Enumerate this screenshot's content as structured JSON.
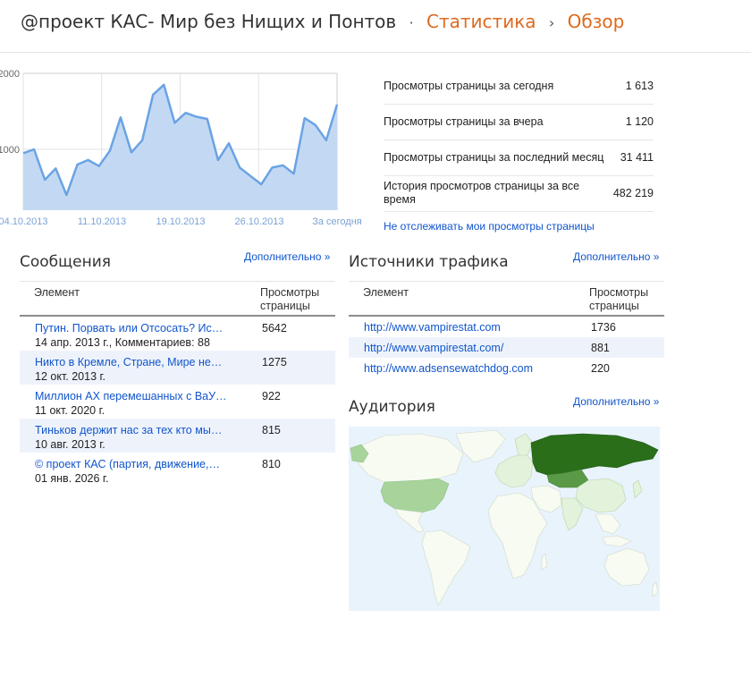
{
  "header": {
    "blog_name": "@проект КАС- Мир без Нищих и Понтов",
    "dot": "·",
    "section": "Статистика",
    "arrow": "›",
    "page": "Обзор"
  },
  "chart_data": {
    "type": "area",
    "x_tick_labels": [
      "04.10.2013",
      "11.10.2013",
      "19.10.2013",
      "26.10.2013",
      "За сегодня"
    ],
    "y_tick_labels": [
      "2000",
      "1000"
    ],
    "ylim": [
      200,
      2000
    ],
    "values": [
      950,
      1000,
      600,
      750,
      400,
      800,
      860,
      780,
      980,
      1420,
      960,
      1120,
      1720,
      1850,
      1350,
      1480,
      1430,
      1400,
      860,
      1080,
      760,
      650,
      540,
      760,
      790,
      680,
      1410,
      1320,
      1120,
      1590
    ],
    "color": "#6aa3e3",
    "fill": "#c3d9f3"
  },
  "stats": {
    "rows": [
      {
        "label": "Просмотры страницы за сегодня",
        "value": "1 613"
      },
      {
        "label": "Просмотры страницы за вчера",
        "value": "1 120"
      },
      {
        "label": "Просмотры страницы за последний месяц",
        "value": "31 411"
      },
      {
        "label": "История просмотров страницы за все время",
        "value": "482 219"
      }
    ],
    "toggle": "Не отслеживать мои просмотры страницы"
  },
  "messages": {
    "title": "Сообщения",
    "more": "Дополнительно »",
    "col_element": "Элемент",
    "col_views": "Просмотры страницы",
    "rows": [
      {
        "title": "Путин. Порвать или Отсосать? Ис…",
        "sub": "14 апр. 2013 г., Комментариев: 88",
        "views": "5642"
      },
      {
        "title": "Никто в Кремле, Стране, Мире не…",
        "sub": "12 окт. 2013 г.",
        "views": "1275"
      },
      {
        "title": "Миллион АХ перемешанных с ВаУ…",
        "sub": "11 окт. 2020 г.",
        "views": "922"
      },
      {
        "title": "Тиньков держит нас за тех кто мы…",
        "sub": "10 авг. 2013 г.",
        "views": "815"
      },
      {
        "title": "© проект КАС (партия, движение,…",
        "sub": "01 янв. 2026 г.",
        "views": "810"
      }
    ]
  },
  "traffic": {
    "title": "Источники трафика",
    "more": "Дополнительно »",
    "col_element": "Элемент",
    "col_views": "Просмотры страницы",
    "rows": [
      {
        "url": "http://www.vampirestat.com",
        "views": "1736"
      },
      {
        "url": "http://www.vampirestat.com/",
        "views": "881"
      },
      {
        "url": "http://www.adsensewatchdog.com",
        "views": "220"
      }
    ]
  },
  "audience": {
    "title": "Аудитория",
    "more": "Дополнительно »",
    "colors": {
      "water": "#e9f3fc",
      "land": "#f8fbf2",
      "low": "#e3f2da",
      "mid": "#a8d49b",
      "high": "#2a6e1a"
    }
  }
}
